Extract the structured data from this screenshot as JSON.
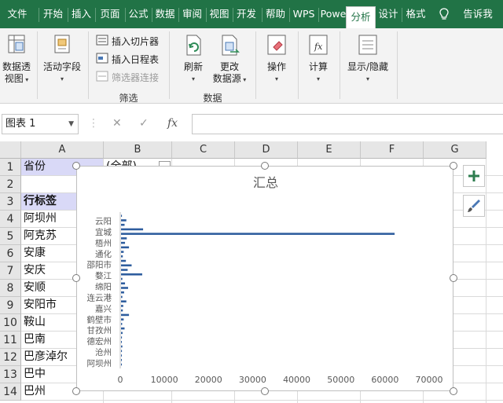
{
  "tabs": [
    {
      "label": "文件",
      "active": false
    },
    {
      "label": "开始",
      "active": false
    },
    {
      "label": "插入",
      "active": false
    },
    {
      "label": "页面",
      "active": false
    },
    {
      "label": "公式",
      "active": false
    },
    {
      "label": "数据",
      "active": false
    },
    {
      "label": "审阅",
      "active": false
    },
    {
      "label": "视图",
      "active": false
    },
    {
      "label": "开发",
      "active": false
    },
    {
      "label": "帮助",
      "active": false
    },
    {
      "label": "WPS",
      "active": false
    },
    {
      "label": "Powe",
      "active": false
    },
    {
      "label": "分析",
      "active": true
    },
    {
      "label": "设计",
      "active": false
    },
    {
      "label": "格式",
      "active": false
    }
  ],
  "tell_me": "告诉我",
  "ribbon": {
    "pivot_table": {
      "line1": "数据透",
      "line2": "视图"
    },
    "active_field": "活动字段",
    "insert_slicer": "插入切片器",
    "insert_timeline": "插入日程表",
    "filter_connections": "筛选器连接",
    "filter_group": "筛选",
    "refresh": "刷新",
    "change_source": {
      "line1": "更改",
      "line2": "数据源"
    },
    "data_group": "数据",
    "actions": "操作",
    "calculations": "计算",
    "show_hide": "显示/隐藏"
  },
  "formula_bar": {
    "name_box": "图表 1",
    "formula": ""
  },
  "columns": [
    "A",
    "B",
    "C",
    "D",
    "E",
    "F",
    "G"
  ],
  "rows": [
    {
      "num": "1",
      "a": "省份",
      "b": "(全部)"
    },
    {
      "num": "2",
      "a": "",
      "b": ""
    },
    {
      "num": "3",
      "a": "行标签",
      "b": ""
    },
    {
      "num": "4",
      "a": "阿坝州",
      "b": ""
    },
    {
      "num": "5",
      "a": "阿克苏",
      "b": ""
    },
    {
      "num": "6",
      "a": "安康",
      "b": ""
    },
    {
      "num": "7",
      "a": "安庆",
      "b": ""
    },
    {
      "num": "8",
      "a": "安顺",
      "b": ""
    },
    {
      "num": "9",
      "a": "安阳市",
      "b": ""
    },
    {
      "num": "10",
      "a": "鞍山",
      "b": ""
    },
    {
      "num": "11",
      "a": "巴南",
      "b": ""
    },
    {
      "num": "12",
      "a": "巴彦淖尔",
      "b": ""
    },
    {
      "num": "13",
      "a": "巴中",
      "b": ""
    },
    {
      "num": "14",
      "a": "巴州",
      "b": ""
    }
  ],
  "colors": {
    "ribbon_green": "#217346",
    "bar_blue": "#2e5d9e",
    "highlight": "#d9d9f7"
  },
  "chart_data": {
    "type": "bar",
    "orientation": "horizontal",
    "title": "汇总",
    "xlim": [
      0,
      70000
    ],
    "xticks": [
      0,
      10000,
      20000,
      30000,
      40000,
      50000,
      60000,
      70000
    ],
    "category_labels": [
      "云阳",
      "宜城",
      "梧州",
      "通化",
      "邵阳市",
      "婺江",
      "绵阳",
      "连云港",
      "嘉兴",
      "鹤壁市",
      "甘孜州",
      "德宏州",
      "沧州",
      "阿坝州"
    ],
    "values": [
      200,
      1200,
      800,
      5000,
      62000,
      1300,
      900,
      1800,
      600,
      400,
      1100,
      2400,
      1500,
      4800,
      300,
      900,
      1600,
      700,
      300,
      1200,
      500,
      400,
      1800,
      600,
      250,
      800,
      350,
      200,
      150,
      300,
      200,
      100,
      180,
      120
    ],
    "grid": false,
    "legend": "none"
  }
}
